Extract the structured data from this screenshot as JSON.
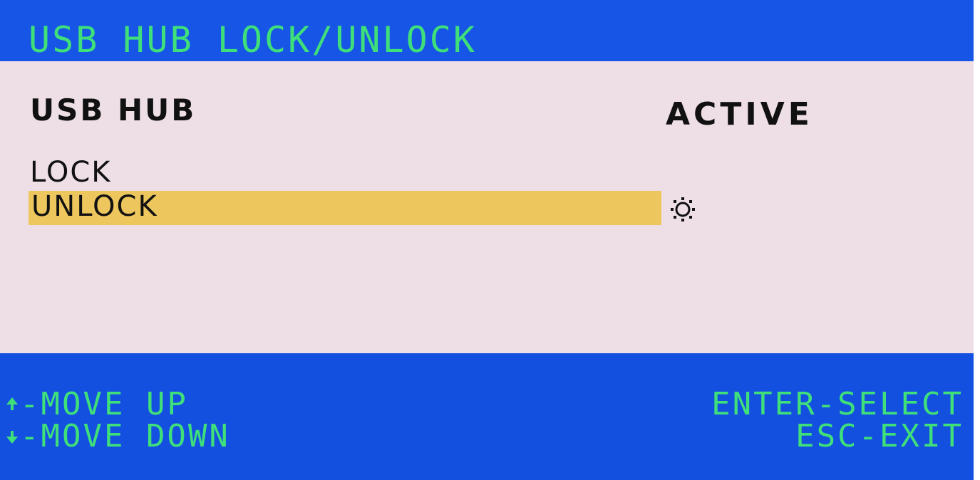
{
  "header": {
    "title": "USB HUB LOCK/UNLOCK"
  },
  "panel": {
    "hub_label": "USB HUB",
    "hub_status": "ACTIVE",
    "options": [
      {
        "label": "LOCK",
        "selected": false
      },
      {
        "label": "UNLOCK",
        "selected": true
      }
    ],
    "current_indicator_icon": "sun-icon"
  },
  "footer": {
    "move_up": {
      "icon": "arrow-up-icon",
      "label": "-MOVE UP"
    },
    "move_down": {
      "icon": "arrow-down-icon",
      "label": "-MOVE DOWN"
    },
    "enter": "ENTER-SELECT",
    "esc": "ESC-EXIT"
  },
  "colors": {
    "background_blue": "#1450e0",
    "text_green": "#3fe07a",
    "panel_pink": "#eedfe6",
    "highlight_yellow": "#eec65e",
    "text_black": "#111111"
  }
}
